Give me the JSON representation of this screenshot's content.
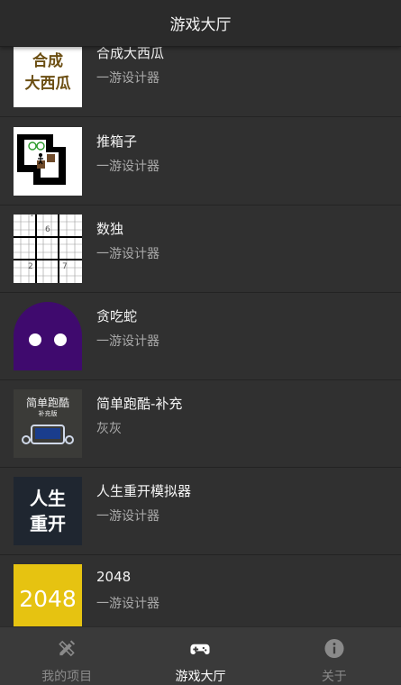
{
  "header": {
    "title": "游戏大厅"
  },
  "games": [
    {
      "name": "合成大西瓜",
      "author": "一游设计器",
      "thumb_text": [
        "合成",
        "大西瓜"
      ]
    },
    {
      "name": "推箱子",
      "author": "一游设计器"
    },
    {
      "name": "数独",
      "author": "一游设计器",
      "thumb_digits": [
        "6",
        "2",
        "7",
        "1"
      ]
    },
    {
      "name": "贪吃蛇",
      "author": "一游设计器"
    },
    {
      "name": "简单跑酷-补充",
      "author": "灰灰",
      "thumb_text": [
        "简单跑酷",
        "补充版"
      ]
    },
    {
      "name": "人生重开模拟器",
      "author": "一游设计器",
      "thumb_text": [
        "人生",
        "重开"
      ]
    },
    {
      "name": "2048",
      "author": "一游设计器",
      "thumb_text": [
        "2048"
      ]
    }
  ],
  "tabs": [
    {
      "label": "我的项目",
      "icon": "pencil-ruler-icon",
      "active": false
    },
    {
      "label": "游戏大厅",
      "icon": "gamepad-icon",
      "active": true
    },
    {
      "label": "关于",
      "icon": "info-icon",
      "active": false
    }
  ],
  "colors": {
    "active_tab": "#ffffff",
    "inactive_tab": "#8a8a8a",
    "background": "#303030"
  }
}
